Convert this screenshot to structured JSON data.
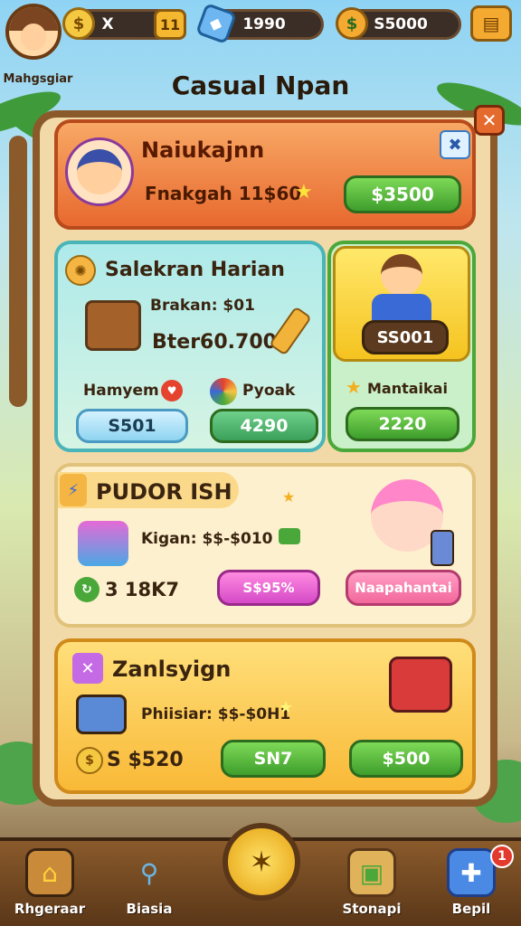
{
  "header": {
    "player_name": "Mahgsgiar",
    "currencies": [
      {
        "icon": "coin-icon",
        "value": "X",
        "plus": "11"
      },
      {
        "icon": "gem-icon",
        "value": "1990"
      },
      {
        "icon": "cash-icon",
        "value": "S5000"
      }
    ],
    "title": "Casual Npan"
  },
  "offers": {
    "featured": {
      "title": "Naiukajnn",
      "subtitle": "Fnakgah 11$60",
      "button": "$3500"
    },
    "daily": {
      "title": "Salekran Harian",
      "price_label": "Brakan: $01",
      "total": "Bter60.700",
      "left_label": "Hamyem",
      "left_button": "S501",
      "right_label": "Pyoak",
      "right_button": "4290"
    },
    "hero": {
      "price": "SS001",
      "label": "Mantaikai",
      "button": "2220"
    },
    "promo": {
      "title": "PUDOR ISH",
      "price_label": "Kigan: $$-$010",
      "counter": "3  18K7",
      "button": "S$95%",
      "action": "Naapahantai"
    },
    "bundle": {
      "title": "Zanlsyign",
      "price_label": "Phiisiar: $$-$0H1",
      "coins": "S $520",
      "button_left": "SN7",
      "button_right": "$500"
    }
  },
  "nav": {
    "items": [
      {
        "label": "Rhgeraar",
        "icon": "home-icon"
      },
      {
        "label": "Biasia",
        "icon": "magnifier-icon"
      },
      {
        "label": "Stonapi",
        "icon": "shop-box-icon"
      },
      {
        "label": "Bepil",
        "icon": "puzzle-icon",
        "badge": "1"
      }
    ],
    "center_icon": "compass-icon"
  },
  "colors": {
    "featured_bg": "#f2874b",
    "daily_bg": "#9fe3e6",
    "hero_bg": "#ffd93b",
    "promo_bg": "#fdf0cf",
    "bundle_bg": "#ffcf5a"
  }
}
